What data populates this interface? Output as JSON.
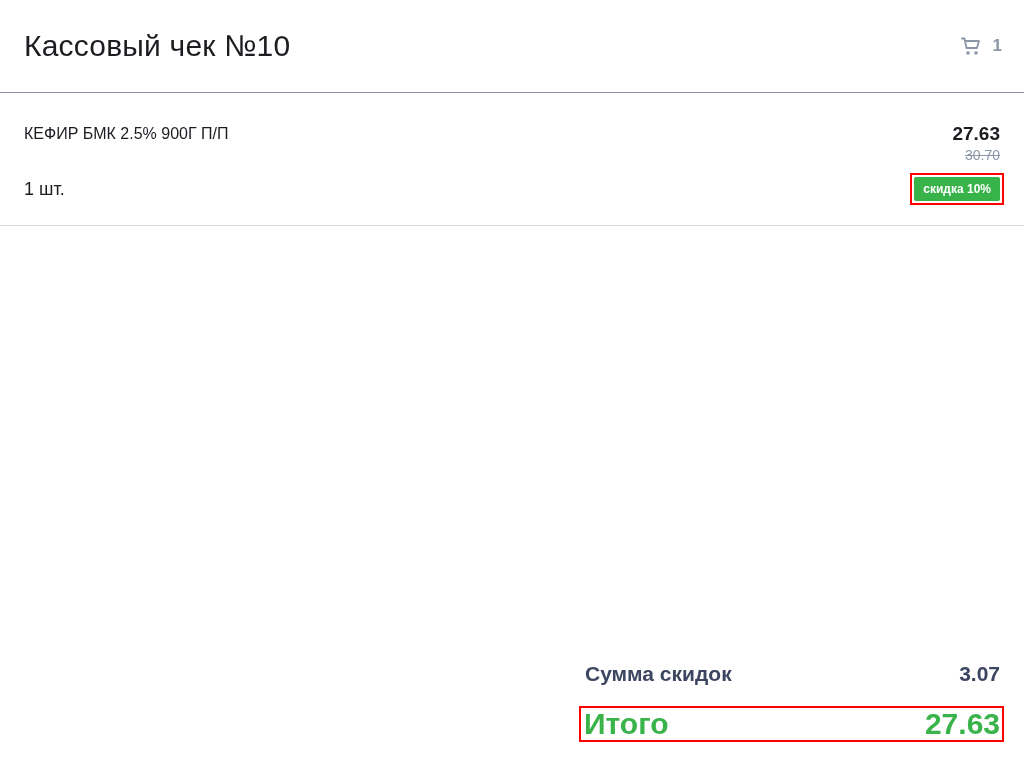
{
  "header": {
    "title": "Кассовый чек №10",
    "cart_count": "1"
  },
  "items": [
    {
      "name": "КЕФИР БМК 2.5% 900Г П/П",
      "price": "27.63",
      "old_price": "30.70",
      "quantity": "1 шт.",
      "discount_badge": {
        "label": "скидка 10%",
        "highlighted": true
      }
    }
  ],
  "summary": {
    "discount_total": {
      "label": "Сумма скидок",
      "value": "3.07"
    },
    "total": {
      "label": "Итого",
      "value": "27.63",
      "highlighted": true
    }
  }
}
